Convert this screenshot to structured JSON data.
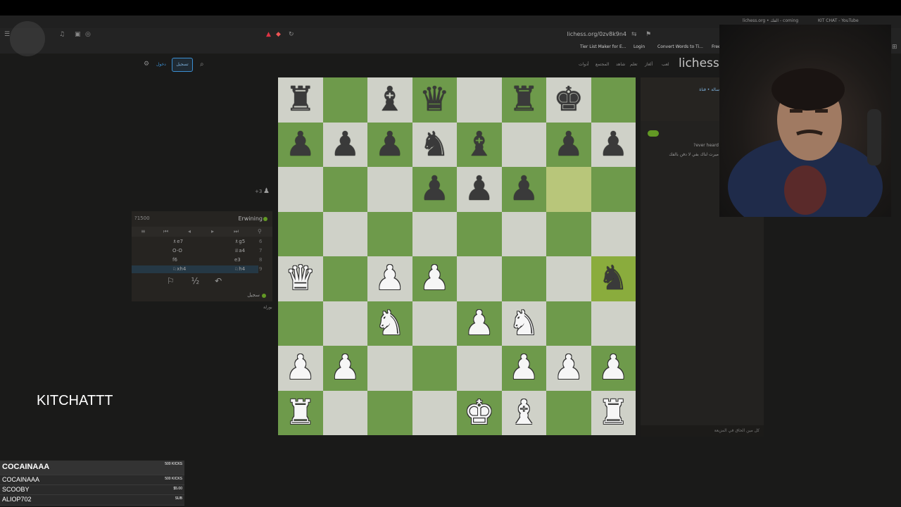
{
  "browser": {
    "url": "lichess.org/0zv8k9n4",
    "tabs": [
      "lichess.org • الفك - coming",
      "KIT CHAT - YouTube"
    ],
    "bookmarks": [
      "Tier List Maker for E...",
      "Login",
      "Convert Words to Ti...",
      "Free"
    ]
  },
  "lichess": {
    "logo": "lichess.o",
    "nav": [
      "لعب",
      "ألغاز",
      "تعلم",
      "شاهد",
      "المجتمع",
      "أدوات"
    ],
    "signin_label": "تسجيل",
    "register_label": "دخول"
  },
  "board": {
    "orientation": "white",
    "highlight_squares": [
      "g6",
      "h4"
    ],
    "pieces": [
      {
        "sq": "a8",
        "p": "r"
      },
      {
        "sq": "c8",
        "p": "b"
      },
      {
        "sq": "d8",
        "p": "q"
      },
      {
        "sq": "f8",
        "p": "r"
      },
      {
        "sq": "g8",
        "p": "k"
      },
      {
        "sq": "a7",
        "p": "p"
      },
      {
        "sq": "b7",
        "p": "p"
      },
      {
        "sq": "c7",
        "p": "p"
      },
      {
        "sq": "d7",
        "p": "n"
      },
      {
        "sq": "e7",
        "p": "b"
      },
      {
        "sq": "g7",
        "p": "p"
      },
      {
        "sq": "h7",
        "p": "p"
      },
      {
        "sq": "d6",
        "p": "p"
      },
      {
        "sq": "e6",
        "p": "p"
      },
      {
        "sq": "f6",
        "p": "p"
      },
      {
        "sq": "a4",
        "p": "Q"
      },
      {
        "sq": "c4",
        "p": "P"
      },
      {
        "sq": "d4",
        "p": "P"
      },
      {
        "sq": "h4",
        "p": "n"
      },
      {
        "sq": "c3",
        "p": "N"
      },
      {
        "sq": "e3",
        "p": "P"
      },
      {
        "sq": "f3",
        "p": "N"
      },
      {
        "sq": "a2",
        "p": "P"
      },
      {
        "sq": "b2",
        "p": "P"
      },
      {
        "sq": "f2",
        "p": "P"
      },
      {
        "sq": "g2",
        "p": "P"
      },
      {
        "sq": "h2",
        "p": "P"
      },
      {
        "sq": "a1",
        "p": "R"
      },
      {
        "sq": "e1",
        "p": "K"
      },
      {
        "sq": "f1",
        "p": "B"
      },
      {
        "sq": "h1",
        "p": "R"
      }
    ]
  },
  "game": {
    "opponent": "Erwining",
    "opponent_rating": "?1500",
    "me": "سجيل",
    "resign_hint": "بورلة",
    "timer_badge": "+3",
    "moves": [
      {
        "n": "6",
        "w": "♗g5",
        "b": "♗e7"
      },
      {
        "n": "7",
        "w": "♕a4",
        "b": "O-O"
      },
      {
        "n": "8",
        "w": "e3",
        "b": "f6"
      },
      {
        "n": "9",
        "w": "♘h4",
        "b": "♘xh4"
      }
    ],
    "draw_label": "½"
  },
  "chat": {
    "line1": "رسالة • قناة",
    "line2": "?ever heard",
    "line3": "ميرت لناك بفي لا دفن بالفك",
    "input_placeholder": "كل مين الحاق في المزيعة"
  },
  "overlay": {
    "kitchat": "KITCHATTT",
    "donations": [
      {
        "name": "COCAINAAA",
        "amount": "500 KICKS"
      },
      {
        "name": "COCAINAAA",
        "amount": "500 KICKS"
      },
      {
        "name": "SCOOBY",
        "amount": "$5.00"
      },
      {
        "name": "ALIOP702",
        "amount": "SUB"
      }
    ]
  }
}
